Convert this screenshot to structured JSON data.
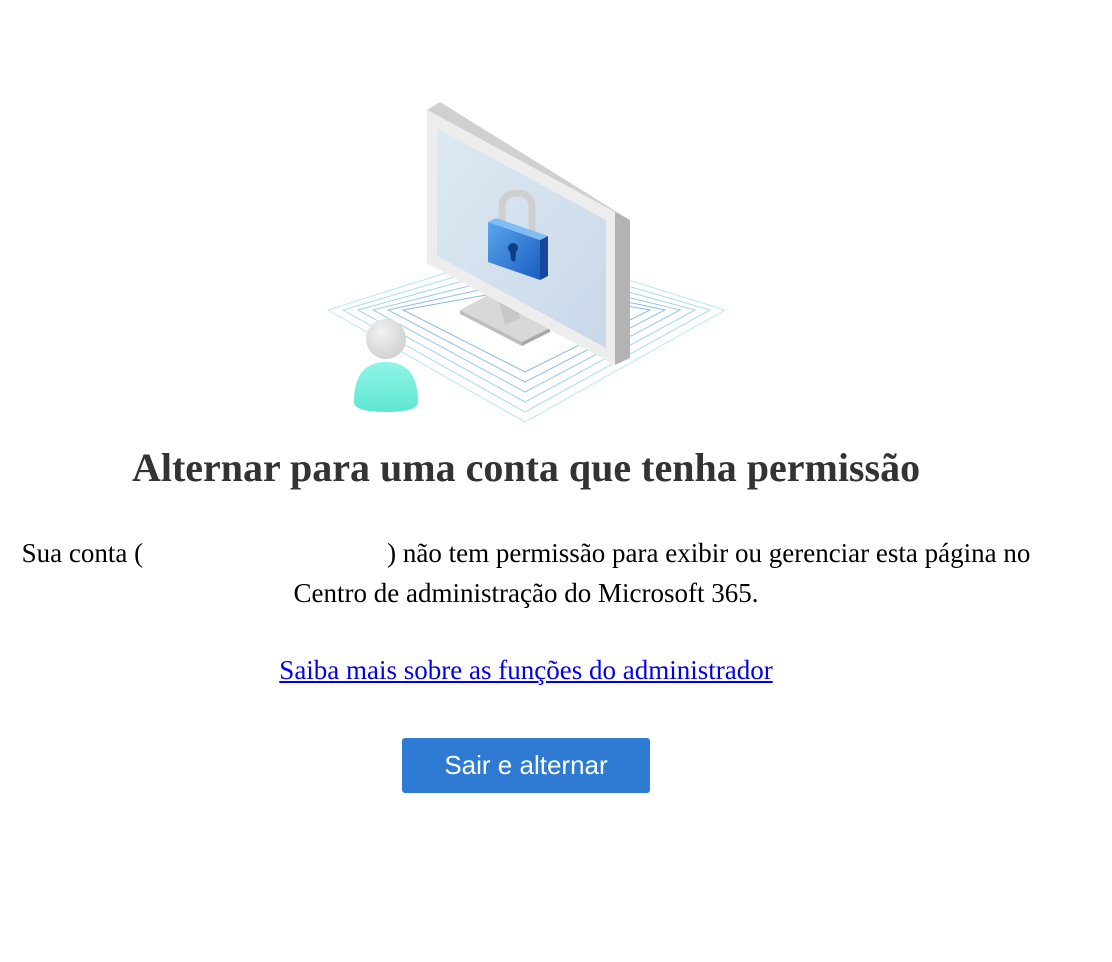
{
  "heading": "Alternar para uma conta que tenha permissão",
  "message": {
    "prefix": "Sua conta (",
    "suffix": ") não tem permissão para exibir ou gerenciar esta página no Centro de administração do Microsoft 365."
  },
  "learn_more_link": "Saiba mais sobre as funções do administrador",
  "sign_out_button": "Sair e alternar",
  "colors": {
    "button_bg": "#2f7bd4",
    "link": "#0000ee",
    "heading": "#333333",
    "lock_blue": "#1e6fd0",
    "avatar_body": "#6ff0dc"
  },
  "illustration": {
    "icons": [
      "monitor-icon",
      "padlock-icon",
      "user-avatar-icon"
    ]
  }
}
